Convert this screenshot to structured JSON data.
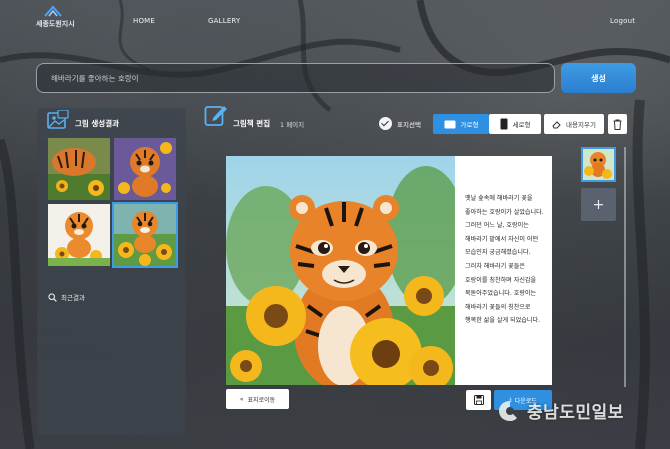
{
  "nav": {
    "logo_text": "세종도원지시",
    "home": "HOME",
    "gallery": "GALLERY",
    "logout": "Logout"
  },
  "search": {
    "placeholder": "해바라기를 좋아하는 호랑이",
    "generate_label": "생성"
  },
  "results": {
    "title": "그림 생성결과",
    "recent_label": "최근결과",
    "thumbnails": [
      "tiger-1",
      "tiger-2",
      "tiger-3",
      "tiger-4"
    ],
    "selected_index": 3
  },
  "editor": {
    "title": "그림책 편집",
    "page_count": "1 페이지",
    "cover_select_label": "표지선택",
    "landscape_label": "가로형",
    "portrait_label": "세로형",
    "erase_label": "내용지우기",
    "story_text": "옛날 숲속에 해바라기 꽃을 좋아하는 호랑이가 살았습니다. 그러던 어느 날, 호랑이는 해바라기 밭에서 자신이 어떤 모습인지 궁금해졌습니다. 그러자 해바라기 꽃들은 호랑이를 칭찬하며 자신감을 북돋아주었습니다. 호랑이는 해바라기 꽃들의 칭찬으로 행복한 삶을 살게 되었습니다.",
    "cover_move_label": "표지로이동",
    "download_label": "다운로드",
    "add_page_symbol": "+"
  },
  "watermark": {
    "text": "충남도민일보"
  },
  "colors": {
    "accent": "#2f8fe0",
    "panel": "#3e444c"
  }
}
